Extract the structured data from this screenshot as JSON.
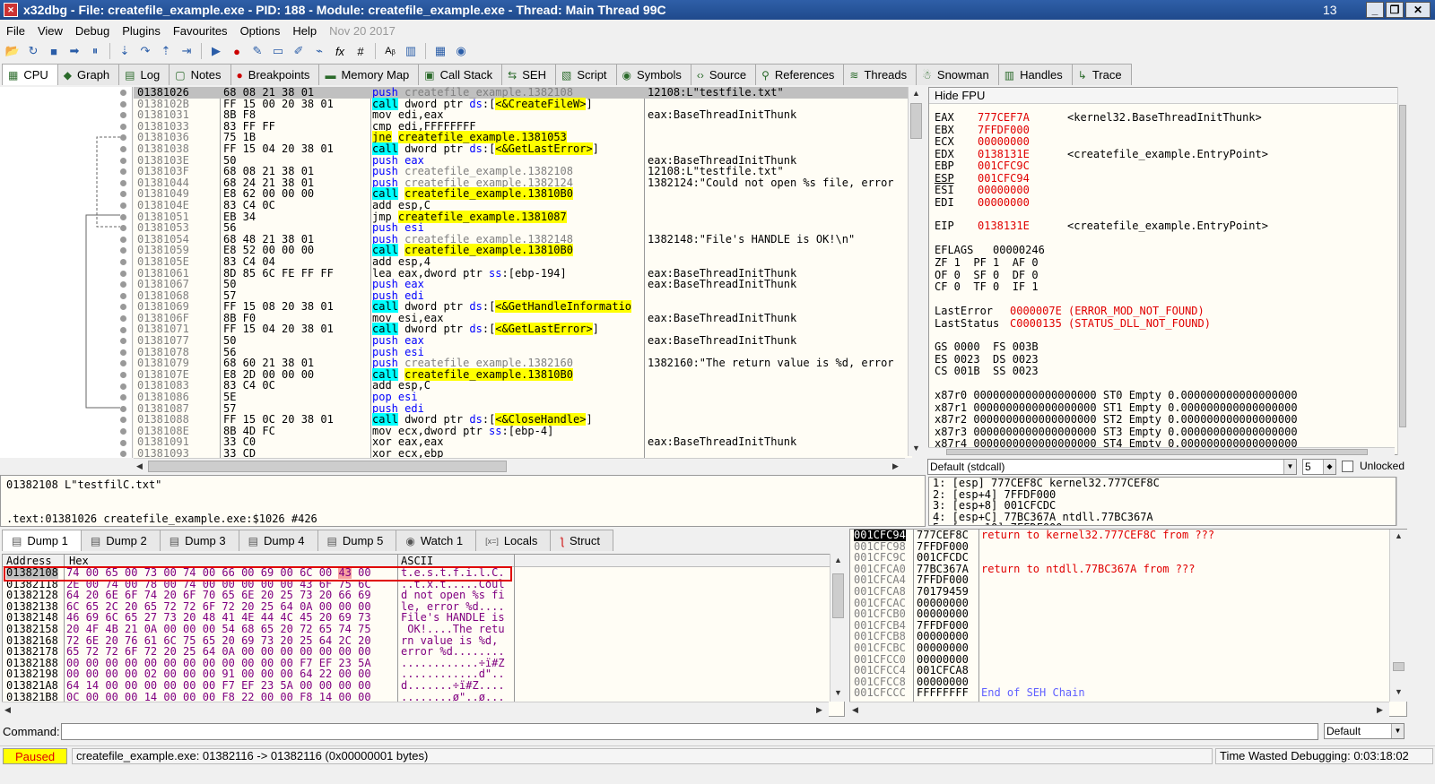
{
  "window": {
    "title": "x32dbg - File: createfile_example.exe - PID: 188 - Module: createfile_example.exe - Thread: Main Thread 99C",
    "counter": "13"
  },
  "menu": [
    "File",
    "View",
    "Debug",
    "Plugins",
    "Favourites",
    "Options",
    "Help"
  ],
  "menu_date": "Nov 20 2017",
  "toolbar_icons": [
    "open-icon",
    "restart-icon",
    "stop-icon",
    "run-icon",
    "pause-icon",
    "step-into-icon",
    "step-over-icon",
    "execute-till-return-icon",
    "run-to-user-code-icon",
    "animate-icon",
    "breakpoint-icon",
    "script-icon",
    "patch-icon",
    "highlight-icon",
    "trace-icon",
    "fx-icon",
    "hash-icon",
    "font-icon",
    "memory-icon",
    "calculator-icon",
    "plugin-icon"
  ],
  "toolbar_glyphs": {
    "fx": "fx",
    "hash": "#",
    "font": "Aᵦ"
  },
  "tabs": [
    {
      "label": "CPU",
      "icon": "cpu-icon",
      "glyph": "▦",
      "active": true
    },
    {
      "label": "Graph",
      "icon": "graph-icon",
      "glyph": "◆"
    },
    {
      "label": "Log",
      "icon": "log-icon",
      "glyph": "▤"
    },
    {
      "label": "Notes",
      "icon": "notes-icon",
      "glyph": "▢"
    },
    {
      "label": "Breakpoints",
      "icon": "breakpoint-icon",
      "glyph": "●"
    },
    {
      "label": "Memory Map",
      "icon": "memory-map-icon",
      "glyph": "▬"
    },
    {
      "label": "Call Stack",
      "icon": "call-stack-icon",
      "glyph": "▣"
    },
    {
      "label": "SEH",
      "icon": "seh-icon",
      "glyph": "⇆"
    },
    {
      "label": "Script",
      "icon": "script-icon",
      "glyph": "▧"
    },
    {
      "label": "Symbols",
      "icon": "symbols-icon",
      "glyph": "◉"
    },
    {
      "label": "Source",
      "icon": "source-icon",
      "glyph": "‹›"
    },
    {
      "label": "References",
      "icon": "references-icon",
      "glyph": "⚲"
    },
    {
      "label": "Threads",
      "icon": "threads-icon",
      "glyph": "≋"
    },
    {
      "label": "Snowman",
      "icon": "snowman-icon",
      "glyph": "☃"
    },
    {
      "label": "Handles",
      "icon": "handles-icon",
      "glyph": "▥"
    },
    {
      "label": "Trace",
      "icon": "trace-icon",
      "glyph": "↳"
    }
  ],
  "disassembly": [
    {
      "addr": "01381026",
      "bytes": "68 08 21 38 01",
      "instr": [
        {
          "t": "push ",
          "c": "kw"
        },
        {
          "t": "createfile_example.1382108",
          "c": "gray"
        }
      ],
      "cmt": "12108:L\"testfile.txt\"",
      "sel": true
    },
    {
      "addr": "0138102B",
      "bytes": "FF 15 00 20 38 01",
      "instr": [
        {
          "t": "call",
          "c": "hl-call"
        },
        {
          "t": " dword ptr ",
          "c": ""
        },
        {
          "t": "ds",
          "c": "kw"
        },
        {
          "t": ":[",
          "c": ""
        },
        {
          "t": "<&CreateFileW>",
          "c": "hl-y"
        },
        {
          "t": "]",
          "c": ""
        }
      ],
      "cmt": ""
    },
    {
      "addr": "01381031",
      "bytes": "8B F8",
      "instr": [
        {
          "t": "mov edi,eax",
          "c": ""
        }
      ],
      "cmt": "eax:BaseThreadInitThunk"
    },
    {
      "addr": "01381033",
      "bytes": "83 FF FF",
      "instr": [
        {
          "t": "cmp edi,FFFFFFFF",
          "c": ""
        }
      ],
      "cmt": ""
    },
    {
      "addr": "01381036",
      "bytes": "75 1B",
      "instr": [
        {
          "t": "jne",
          "c": "hl-y"
        },
        {
          "t": " ",
          "c": ""
        },
        {
          "t": "createfile_example.1381053",
          "c": "hl-y"
        }
      ],
      "cmt": ""
    },
    {
      "addr": "01381038",
      "bytes": "FF 15 04 20 38 01",
      "instr": [
        {
          "t": "call",
          "c": "hl-call"
        },
        {
          "t": " dword ptr ",
          "c": ""
        },
        {
          "t": "ds",
          "c": "kw"
        },
        {
          "t": ":[",
          "c": ""
        },
        {
          "t": "<&GetLastError>",
          "c": "hl-y"
        },
        {
          "t": "]",
          "c": ""
        }
      ],
      "cmt": ""
    },
    {
      "addr": "0138103E",
      "bytes": "50",
      "instr": [
        {
          "t": "push eax",
          "c": "kw"
        }
      ],
      "cmt": "eax:BaseThreadInitThunk"
    },
    {
      "addr": "0138103F",
      "bytes": "68 08 21 38 01",
      "instr": [
        {
          "t": "push ",
          "c": "kw"
        },
        {
          "t": "createfile_example.1382108",
          "c": "gray"
        }
      ],
      "cmt": "12108:L\"testfile.txt\""
    },
    {
      "addr": "01381044",
      "bytes": "68 24 21 38 01",
      "instr": [
        {
          "t": "push ",
          "c": "kw"
        },
        {
          "t": "createfile_example.1382124",
          "c": "gray"
        }
      ],
      "cmt": "1382124:\"Could not open %s file, error"
    },
    {
      "addr": "01381049",
      "bytes": "E8 62 00 00 00",
      "instr": [
        {
          "t": "call",
          "c": "hl-call"
        },
        {
          "t": " ",
          "c": ""
        },
        {
          "t": "createfile_example.13810B0",
          "c": "hl-y"
        }
      ],
      "cmt": ""
    },
    {
      "addr": "0138104E",
      "bytes": "83 C4 0C",
      "instr": [
        {
          "t": "add esp,C",
          "c": ""
        }
      ],
      "cmt": ""
    },
    {
      "addr": "01381051",
      "bytes": "EB 34",
      "instr": [
        {
          "t": "jmp ",
          "c": ""
        },
        {
          "t": "createfile_example.1381087",
          "c": "hl-y"
        }
      ],
      "cmt": ""
    },
    {
      "addr": "01381053",
      "bytes": "56",
      "instr": [
        {
          "t": "push esi",
          "c": "kw"
        }
      ],
      "cmt": ""
    },
    {
      "addr": "01381054",
      "bytes": "68 48 21 38 01",
      "instr": [
        {
          "t": "push ",
          "c": "kw"
        },
        {
          "t": "createfile_example.1382148",
          "c": "gray"
        }
      ],
      "cmt": "1382148:\"File's HANDLE is OK!\\n\""
    },
    {
      "addr": "01381059",
      "bytes": "E8 52 00 00 00",
      "instr": [
        {
          "t": "call",
          "c": "hl-call"
        },
        {
          "t": " ",
          "c": ""
        },
        {
          "t": "createfile_example.13810B0",
          "c": "hl-y"
        }
      ],
      "cmt": ""
    },
    {
      "addr": "0138105E",
      "bytes": "83 C4 04",
      "instr": [
        {
          "t": "add esp,4",
          "c": ""
        }
      ],
      "cmt": ""
    },
    {
      "addr": "01381061",
      "bytes": "8D 85 6C FE FF FF",
      "instr": [
        {
          "t": "lea eax,dword ptr ",
          "c": ""
        },
        {
          "t": "ss",
          "c": "kw"
        },
        {
          "t": ":[",
          "c": ""
        },
        {
          "t": "ebp-194",
          "c": ""
        },
        {
          "t": "]",
          "c": ""
        }
      ],
      "cmt": "eax:BaseThreadInitThunk"
    },
    {
      "addr": "01381067",
      "bytes": "50",
      "instr": [
        {
          "t": "push eax",
          "c": "kw"
        }
      ],
      "cmt": "eax:BaseThreadInitThunk"
    },
    {
      "addr": "01381068",
      "bytes": "57",
      "instr": [
        {
          "t": "push edi",
          "c": "kw"
        }
      ],
      "cmt": ""
    },
    {
      "addr": "01381069",
      "bytes": "FF 15 08 20 38 01",
      "instr": [
        {
          "t": "call",
          "c": "hl-call"
        },
        {
          "t": " dword ptr ",
          "c": ""
        },
        {
          "t": "ds",
          "c": "kw"
        },
        {
          "t": ":[",
          "c": ""
        },
        {
          "t": "<&GetHandleInformatio",
          "c": "hl-y"
        }
      ],
      "cmt": ""
    },
    {
      "addr": "0138106F",
      "bytes": "8B F0",
      "instr": [
        {
          "t": "mov esi,eax",
          "c": ""
        }
      ],
      "cmt": "eax:BaseThreadInitThunk"
    },
    {
      "addr": "01381071",
      "bytes": "FF 15 04 20 38 01",
      "instr": [
        {
          "t": "call",
          "c": "hl-call"
        },
        {
          "t": " dword ptr ",
          "c": ""
        },
        {
          "t": "ds",
          "c": "kw"
        },
        {
          "t": ":[",
          "c": ""
        },
        {
          "t": "<&GetLastError>",
          "c": "hl-y"
        },
        {
          "t": "]",
          "c": ""
        }
      ],
      "cmt": ""
    },
    {
      "addr": "01381077",
      "bytes": "50",
      "instr": [
        {
          "t": "push eax",
          "c": "kw"
        }
      ],
      "cmt": "eax:BaseThreadInitThunk"
    },
    {
      "addr": "01381078",
      "bytes": "56",
      "instr": [
        {
          "t": "push esi",
          "c": "kw"
        }
      ],
      "cmt": ""
    },
    {
      "addr": "01381079",
      "bytes": "68 60 21 38 01",
      "instr": [
        {
          "t": "push ",
          "c": "kw"
        },
        {
          "t": "createfile_example.1382160",
          "c": "gray"
        }
      ],
      "cmt": "1382160:\"The return value is %d, error"
    },
    {
      "addr": "0138107E",
      "bytes": "E8 2D 00 00 00",
      "instr": [
        {
          "t": "call",
          "c": "hl-call"
        },
        {
          "t": " ",
          "c": ""
        },
        {
          "t": "createfile_example.13810B0",
          "c": "hl-y"
        }
      ],
      "cmt": ""
    },
    {
      "addr": "01381083",
      "bytes": "83 C4 0C",
      "instr": [
        {
          "t": "add esp,C",
          "c": ""
        }
      ],
      "cmt": ""
    },
    {
      "addr": "01381086",
      "bytes": "5E",
      "instr": [
        {
          "t": "pop esi",
          "c": "kw"
        }
      ],
      "cmt": ""
    },
    {
      "addr": "01381087",
      "bytes": "57",
      "instr": [
        {
          "t": "push edi",
          "c": "kw"
        }
      ],
      "cmt": ""
    },
    {
      "addr": "01381088",
      "bytes": "FF 15 0C 20 38 01",
      "instr": [
        {
          "t": "call",
          "c": "hl-call"
        },
        {
          "t": " dword ptr ",
          "c": ""
        },
        {
          "t": "ds",
          "c": "kw"
        },
        {
          "t": ":[",
          "c": ""
        },
        {
          "t": "<&CloseHandle>",
          "c": "hl-y"
        },
        {
          "t": "]",
          "c": ""
        }
      ],
      "cmt": ""
    },
    {
      "addr": "0138108E",
      "bytes": "8B 4D FC",
      "instr": [
        {
          "t": "mov ecx,dword ptr ",
          "c": ""
        },
        {
          "t": "ss",
          "c": "kw"
        },
        {
          "t": ":[",
          "c": ""
        },
        {
          "t": "ebp-4",
          "c": ""
        },
        {
          "t": "]",
          "c": ""
        }
      ],
      "cmt": ""
    },
    {
      "addr": "01381091",
      "bytes": "33 C0",
      "instr": [
        {
          "t": "xor eax,eax",
          "c": ""
        }
      ],
      "cmt": "eax:BaseThreadInitThunk"
    },
    {
      "addr": "01381093",
      "bytes": "33 CD",
      "instr": [
        {
          "t": "xor ecx,ebp",
          "c": ""
        }
      ],
      "cmt": ""
    }
  ],
  "info": {
    "line1": "01382108 L\"testfilC.txt\"",
    "line2": ".text:01381026 createfile_example.exe:$1026 #426"
  },
  "registers": {
    "header": "Hide FPU",
    "gp": [
      {
        "name": "EAX",
        "val": "777CEF7A",
        "cmt": "<kernel32.BaseThreadInitThunk>"
      },
      {
        "name": "EBX",
        "val": "7FFDF000",
        "cmt": ""
      },
      {
        "name": "ECX",
        "val": "00000000",
        "cmt": ""
      },
      {
        "name": "EDX",
        "val": "0138131E",
        "cmt": "<createfile_example.EntryPoint>"
      },
      {
        "name": "EBP",
        "val": "001CFC9C",
        "cmt": ""
      },
      {
        "name": "ESP",
        "val": "001CFC94",
        "cmt": ""
      },
      {
        "name": "ESI",
        "val": "00000000",
        "cmt": ""
      },
      {
        "name": "EDI",
        "val": "00000000",
        "cmt": ""
      }
    ],
    "eip": {
      "name": "EIP",
      "val": "0138131E",
      "cmt": "<createfile_example.EntryPoint>"
    },
    "eflags": "EFLAGS   00000246",
    "flags": [
      "ZF 1  PF 1  AF 0",
      "OF 0  SF 0  DF 0",
      "CF 0  TF 0  IF 1"
    ],
    "lasterror_label": "LastError",
    "lasterror_val": "0000007E (ERROR_MOD_NOT_FOUND)",
    "laststatus_label": "LastStatus",
    "laststatus_val": "C0000135 (STATUS_DLL_NOT_FOUND)",
    "segs": [
      "GS 0000  FS 003B",
      "ES 0023  DS 0023",
      "CS 001B  SS 0023"
    ],
    "fpu": [
      "x87r0 0000000000000000000 ST0 Empty 0.000000000000000000",
      "x87r1 0000000000000000000 ST1 Empty 0.000000000000000000",
      "x87r2 0000000000000000000 ST2 Empty 0.000000000000000000",
      "x87r3 0000000000000000000 ST3 Empty 0.000000000000000000",
      "x87r4 0000000000000000000 ST4 Empty 0.000000000000000000"
    ]
  },
  "callconv": {
    "value": "Default (stdcall)",
    "count": "5",
    "unlocked": "Unlocked"
  },
  "args": [
    "1: [esp] 777CEF8C kernel32.777CEF8C",
    "2: [esp+4] 7FFDF000",
    "3: [esp+8] 001CFCDC",
    "4: [esp+C] 77BC367A ntdll.77BC367A",
    "5: [esp+10] 7FFDF000"
  ],
  "dump_tabs": [
    {
      "label": "Dump 1",
      "icon": "dump-icon",
      "active": true
    },
    {
      "label": "Dump 2",
      "icon": "dump-icon"
    },
    {
      "label": "Dump 3",
      "icon": "dump-icon"
    },
    {
      "label": "Dump 4",
      "icon": "dump-icon"
    },
    {
      "label": "Dump 5",
      "icon": "dump-icon"
    },
    {
      "label": "Watch 1",
      "icon": "watch-icon"
    },
    {
      "label": "Locals",
      "icon": "locals-icon"
    },
    {
      "label": "Struct",
      "icon": "struct-icon"
    }
  ],
  "dump_glyphs": {
    "dump": "▤",
    "watch": "◉",
    "locals": "[x=]",
    "struct": "ƪ"
  },
  "dump": {
    "headers": {
      "address": "Address",
      "hex": "Hex",
      "ascii": "ASCII"
    },
    "rows": [
      {
        "addr": "01382108",
        "hex": "74 00 65 00 73 00 74 00 66 00 69 00 6C 00 43 00",
        "ascii": "t.e.s.t.f.i.l.C."
      },
      {
        "addr": "01382118",
        "hex": "2E 00 74 00 78 00 74 00 00 00 00 00 43 6F 75 6C",
        "ascii": "..t.x.t.....Coul"
      },
      {
        "addr": "01382128",
        "hex": "64 20 6E 6F 74 20 6F 70 65 6E 20 25 73 20 66 69",
        "ascii": "d not open %s fi"
      },
      {
        "addr": "01382138",
        "hex": "6C 65 2C 20 65 72 72 6F 72 20 25 64 0A 00 00 00",
        "ascii": "le, error %d...."
      },
      {
        "addr": "01382148",
        "hex": "46 69 6C 65 27 73 20 48 41 4E 44 4C 45 20 69 73",
        "ascii": "File's HANDLE is"
      },
      {
        "addr": "01382158",
        "hex": "20 4F 4B 21 0A 00 00 00 54 68 65 20 72 65 74 75",
        "ascii": " OK!....The retu"
      },
      {
        "addr": "01382168",
        "hex": "72 6E 20 76 61 6C 75 65 20 69 73 20 25 64 2C 20",
        "ascii": "rn value is %d, "
      },
      {
        "addr": "01382178",
        "hex": "65 72 72 6F 72 20 25 64 0A 00 00 00 00 00 00 00",
        "ascii": "error %d........"
      },
      {
        "addr": "01382188",
        "hex": "00 00 00 00 00 00 00 00 00 00 00 00 F7 EF 23 5A",
        "ascii": "............÷ï#Z"
      },
      {
        "addr": "01382198",
        "hex": "00 00 00 00 02 00 00 00 91 00 00 00 64 22 00 00",
        "ascii": "............d\".."
      },
      {
        "addr": "013821A8",
        "hex": "64 14 00 00 00 00 00 00 F7 EF 23 5A 00 00 00 00",
        "ascii": "d.......÷ï#Z...."
      },
      {
        "addr": "013821B8",
        "hex": "0C 00 00 00 14 00 00 00 F8 22 00 00 F8 14 00 00",
        "ascii": "........ø\"..ø..."
      }
    ]
  },
  "stack": [
    {
      "addr": "001CFC94",
      "val": "777CEF8C",
      "cmt": "return to kernel32.777CEF8C from ???"
    },
    {
      "addr": "001CFC98",
      "val": "7FFDF000",
      "cmt": ""
    },
    {
      "addr": "001CFC9C",
      "val": "001CFCDC",
      "cmt": ""
    },
    {
      "addr": "001CFCA0",
      "val": "77BC367A",
      "cmt": "return to ntdll.77BC367A from ???"
    },
    {
      "addr": "001CFCA4",
      "val": "7FFDF000",
      "cmt": ""
    },
    {
      "addr": "001CFCA8",
      "val": "70179459",
      "cmt": ""
    },
    {
      "addr": "001CFCAC",
      "val": "00000000",
      "cmt": ""
    },
    {
      "addr": "001CFCB0",
      "val": "00000000",
      "cmt": ""
    },
    {
      "addr": "001CFCB4",
      "val": "7FFDF000",
      "cmt": ""
    },
    {
      "addr": "001CFCB8",
      "val": "00000000",
      "cmt": ""
    },
    {
      "addr": "001CFCBC",
      "val": "00000000",
      "cmt": ""
    },
    {
      "addr": "001CFCC0",
      "val": "00000000",
      "cmt": ""
    },
    {
      "addr": "001CFCC4",
      "val": "001CFCA8",
      "cmt": ""
    },
    {
      "addr": "001CFCC8",
      "val": "00000000",
      "cmt": ""
    },
    {
      "addr": "001CFCCC",
      "val": "FFFFFFFF",
      "cmt": "End of SEH Chain"
    }
  ],
  "command": {
    "label": "Command:",
    "value": "",
    "mode": "Default"
  },
  "status": {
    "state": "Paused",
    "message": "createfile_example.exe: 01382116 -> 01382116 (0x00000001 bytes)",
    "time": "Time Wasted Debugging: 0:03:18:02"
  },
  "colors": {
    "paused_bg": "#ffff00",
    "paused_fg": "#e00000",
    "call_hl": "#00ffff",
    "jump_hl": "#ffff00",
    "red": "#e00000"
  }
}
